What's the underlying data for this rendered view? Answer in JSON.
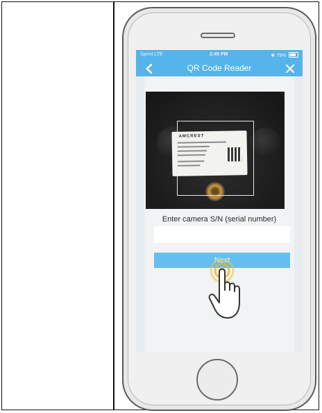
{
  "status_bar": {
    "carrier": "Sprint LTE",
    "time": "2:45 PM",
    "battery": "79%"
  },
  "nav_bar": {
    "title": "QR Code Reader",
    "back_icon": "chevron-left-icon",
    "close_icon": "close-icon"
  },
  "camera_label": {
    "brand": "AMCREST"
  },
  "form": {
    "prompt": "Enter camera S/N (serial number)",
    "serial_value": "",
    "next_label": "Next"
  },
  "colors": {
    "accent": "#55b4ea",
    "button": "#66bdf0"
  }
}
